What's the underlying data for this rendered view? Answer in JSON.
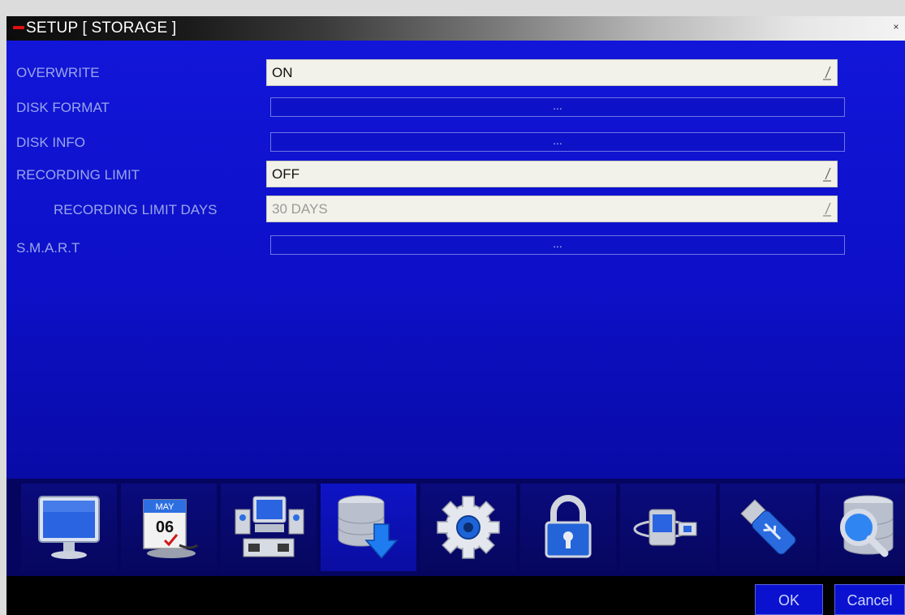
{
  "window": {
    "title": "SETUP [ STORAGE ]",
    "close_glyph": "×"
  },
  "settings": {
    "overwrite": {
      "label": "OVERWRITE",
      "value": "ON"
    },
    "disk_format": {
      "label": "DISK FORMAT",
      "button": "..."
    },
    "disk_info": {
      "label": "DISK INFO",
      "button": "..."
    },
    "recording_limit": {
      "label": "RECORDING LIMIT",
      "value": "OFF"
    },
    "recording_limit_days": {
      "label": "RECORDING LIMIT DAYS",
      "value": "30 DAYS"
    },
    "smart": {
      "label": "S.M.A.R.T",
      "button": "..."
    }
  },
  "iconbar": {
    "items": [
      {
        "name": "display-icon"
      },
      {
        "name": "calendar-icon",
        "month": "MAY",
        "day": "06"
      },
      {
        "name": "system-icon"
      },
      {
        "name": "storage-icon",
        "active": true
      },
      {
        "name": "gear-icon"
      },
      {
        "name": "lock-icon"
      },
      {
        "name": "network-icon"
      },
      {
        "name": "usb-icon"
      },
      {
        "name": "search-database-icon"
      }
    ]
  },
  "footer": {
    "ok_label": "OK",
    "cancel_label": "Cancel"
  },
  "colors": {
    "panel_blue": "#1216d8",
    "label_blue": "#9aa6ea",
    "iconbar_navy": "#050560"
  }
}
